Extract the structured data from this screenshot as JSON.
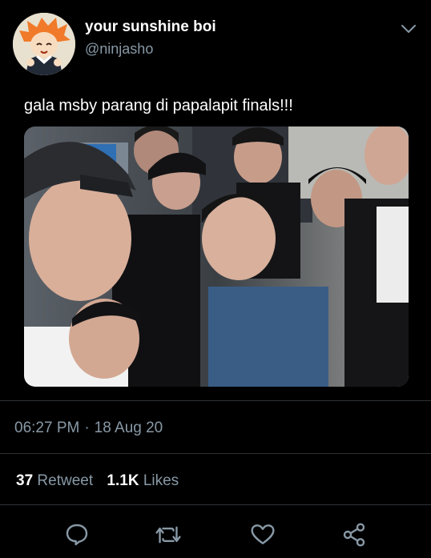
{
  "tweet": {
    "display_name": "your sunshine boi",
    "handle": "@ninjasho",
    "text": "gala msby parang di papalapit finals!!!",
    "time": "06:27 PM",
    "date": "18 Aug 20",
    "separator": "·",
    "retweets_count": "37",
    "retweets_label": "Retweet",
    "likes_count": "1.1K",
    "likes_label": "Likes"
  },
  "icons": {
    "menu": "chevron-down-icon",
    "reply": "reply-icon",
    "retweet": "retweet-icon",
    "like": "heart-icon",
    "share": "share-icon"
  },
  "colors": {
    "background": "#000000",
    "text_primary": "#ffffff",
    "text_secondary": "#8899a6",
    "divider": "#2f3336"
  }
}
